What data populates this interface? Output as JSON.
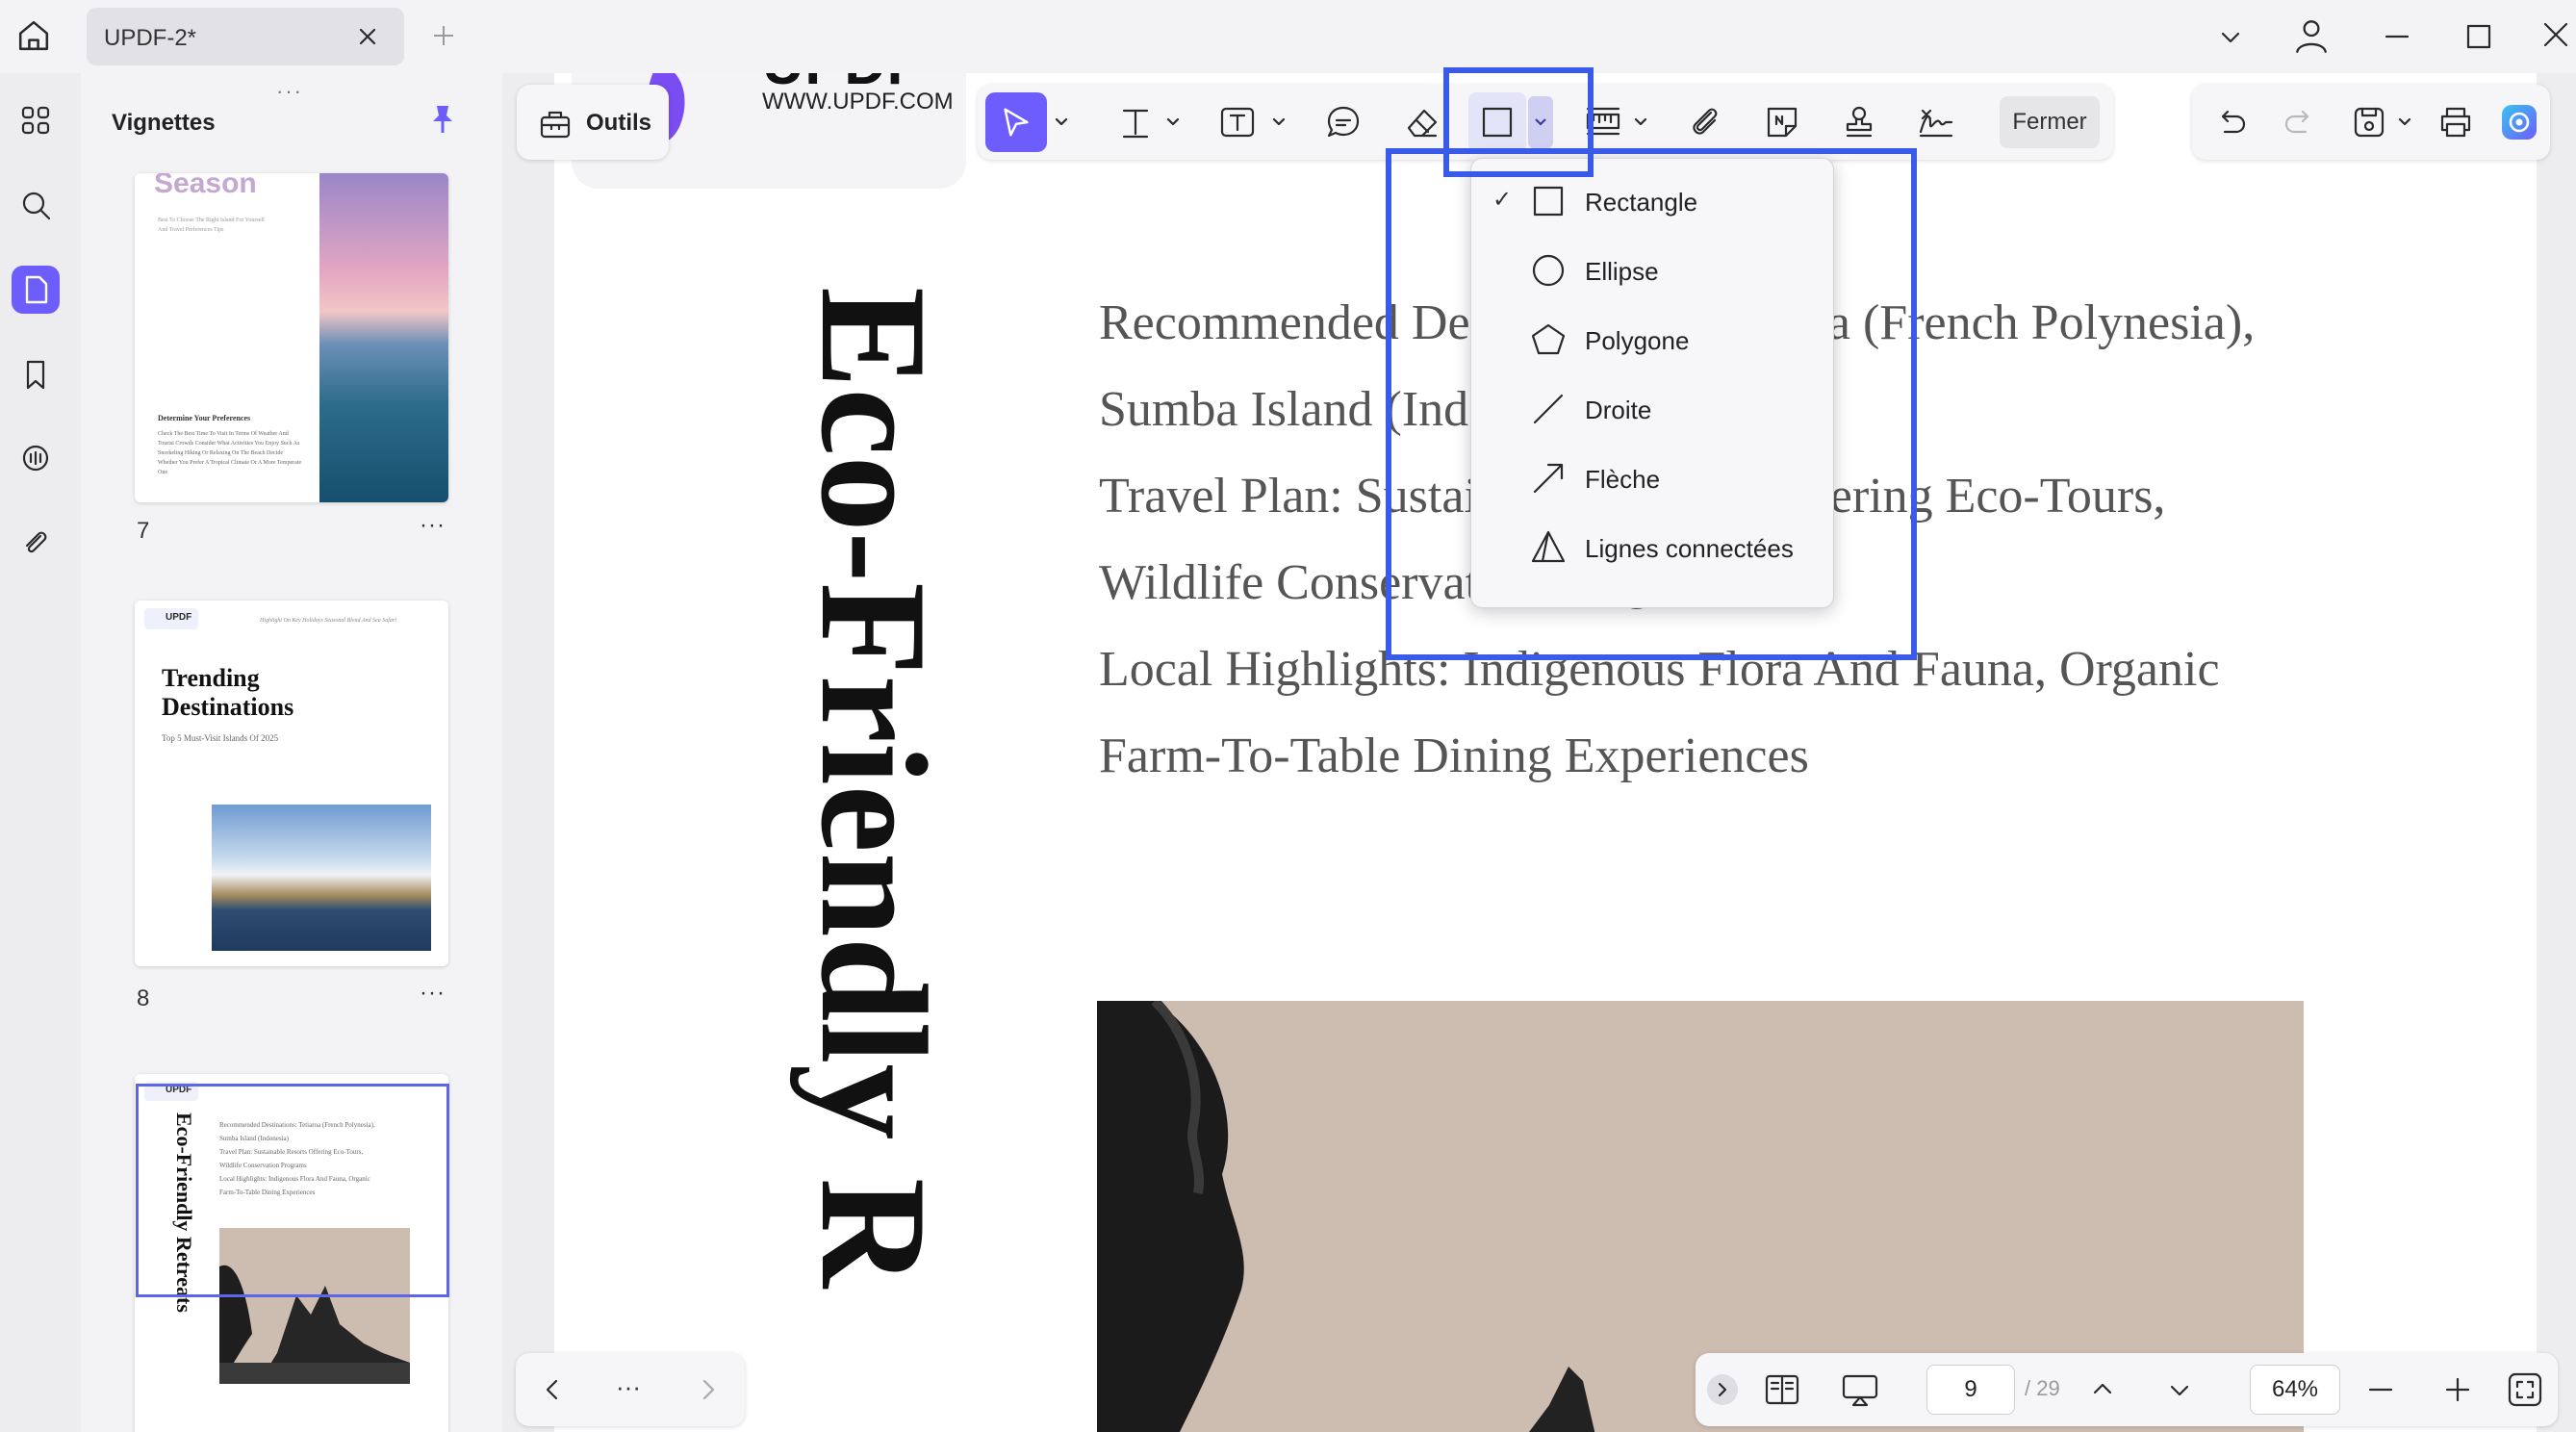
{
  "window": {
    "tab_title": "UPDF-2*"
  },
  "sidebar": {
    "panel_title": "Vignettes",
    "rail_icons": [
      "grid-icon",
      "search-icon",
      "pages-icon",
      "bookmark-icon",
      "comment-icon",
      "attachment-icon"
    ]
  },
  "thumbnails": [
    {
      "page": "7",
      "heading": "Season",
      "sub": "Best To Choose The Right Island For Yourself And Travel Preferences Tips",
      "section": "Determine Your Preferences",
      "body": "Check The Best Time To Visit In Terms Of Weather And Tourist Crowds Consider What Activities You Enjoy Such As Snorkeling Hiking Or Relaxing On The Beach Decide Whether You Prefer A Tropical Climate Or A More Temperate One"
    },
    {
      "page": "8",
      "logo": "UPDF",
      "tagline": "Highlight On Key Holidays Seasonal Blend And Sea Safari",
      "title_line1": "Trending",
      "title_line2": "Destinations",
      "sub": "Top 5 Must-Visit Islands Of 2025"
    },
    {
      "page": "9",
      "logo": "UPDF",
      "vertical_title": "Eco-Friendly Retreats",
      "lines": [
        "Recommended Destinations: Tetiaroa (French Polynesia),",
        "Sumba Island (Indonesia)",
        "Travel Plan: Sustainable Resorts Offering Eco-Tours,",
        "Wildlife Conservation Programs",
        "Local Highlights: Indigenous Flora And Fauna, Organic",
        "Farm-To-Table Dining Experiences"
      ]
    }
  ],
  "toolbar": {
    "tools_label": "Outils",
    "close_label": "Fermer"
  },
  "shape_menu": {
    "items": [
      {
        "label": "Rectangle",
        "checked": "✓",
        "icon": "rectangle-icon"
      },
      {
        "label": "Ellipse",
        "checked": "",
        "icon": "ellipse-icon"
      },
      {
        "label": "Polygone",
        "checked": "",
        "icon": "polygon-icon"
      },
      {
        "label": "Droite",
        "checked": "",
        "icon": "line-icon"
      },
      {
        "label": "Flèche",
        "checked": "",
        "icon": "arrow-icon"
      },
      {
        "label": "Lignes connectées",
        "checked": "",
        "icon": "connected-lines-icon"
      }
    ]
  },
  "document": {
    "logo_text": "UPDF",
    "logo_url": "WWW.UPDF.COM",
    "vertical_title": "Eco-Friendly R",
    "lines": [
      "Recommended Destinations: Tetiaroa (French Polynesia),",
      "Sumba Island (Indonesia)",
      "Travel Plan: Sustainable Resorts Offering Eco-Tours,",
      "Wildlife Conservation Programs",
      "Local Highlights: Indigenous Flora And Fauna, Organic",
      "Farm-To-Table Dining Experiences"
    ]
  },
  "page_nav": {
    "more": "···"
  },
  "status": {
    "current_page": "9",
    "total_pages": "/ 29",
    "zoom": "64%"
  },
  "colors": {
    "accent": "#6c5dfc",
    "highlight": "#3a5ae8"
  }
}
